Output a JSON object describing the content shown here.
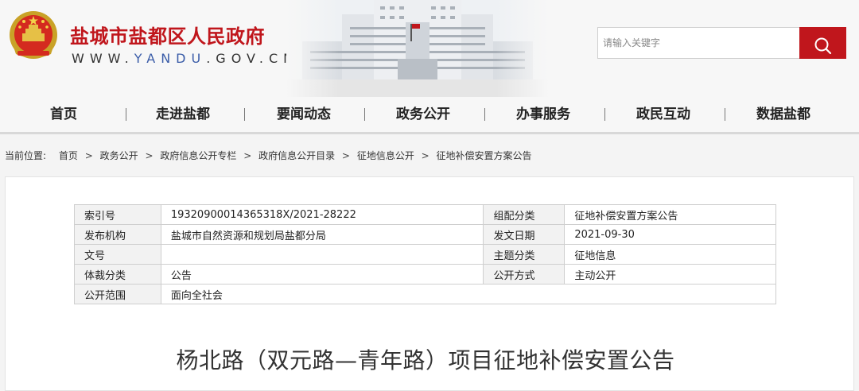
{
  "header": {
    "site_title": "盐城市盐都区人民政府",
    "url_prefix": "WWW.",
    "url_highlight": "YANDU",
    "url_suffix": ".GOV.CN"
  },
  "search": {
    "placeholder": "请输入关键字"
  },
  "nav": {
    "items": [
      "首页",
      "走进盐都",
      "要闻动态",
      "政务公开",
      "办事服务",
      "政民互动",
      "数据盐都"
    ]
  },
  "breadcrumb": {
    "label": "当前位置:",
    "items": [
      "首页",
      "政务公开",
      "政府信息公开专栏",
      "政府信息公开目录",
      "征地信息公开",
      "征地补偿安置方案公告"
    ],
    "separator": ">"
  },
  "meta": {
    "rows": [
      [
        "索引号",
        "19320900014365318X/2021-28222",
        "组配分类",
        "征地补偿安置方案公告"
      ],
      [
        "发布机构",
        "盐城市自然资源和规划局盐都分局",
        "发文日期",
        "2021-09-30"
      ],
      [
        "文号",
        "",
        "主题分类",
        "征地信息"
      ],
      [
        "体裁分类",
        "公告",
        "公开方式",
        "主动公开"
      ],
      [
        "公开范围",
        "面向全社会"
      ]
    ]
  },
  "article": {
    "title": "杨北路（双元路—青年路）项目征地补偿安置公告"
  },
  "colors": {
    "brand_red": "#c0161c",
    "url_blue": "#3a5ca8"
  }
}
